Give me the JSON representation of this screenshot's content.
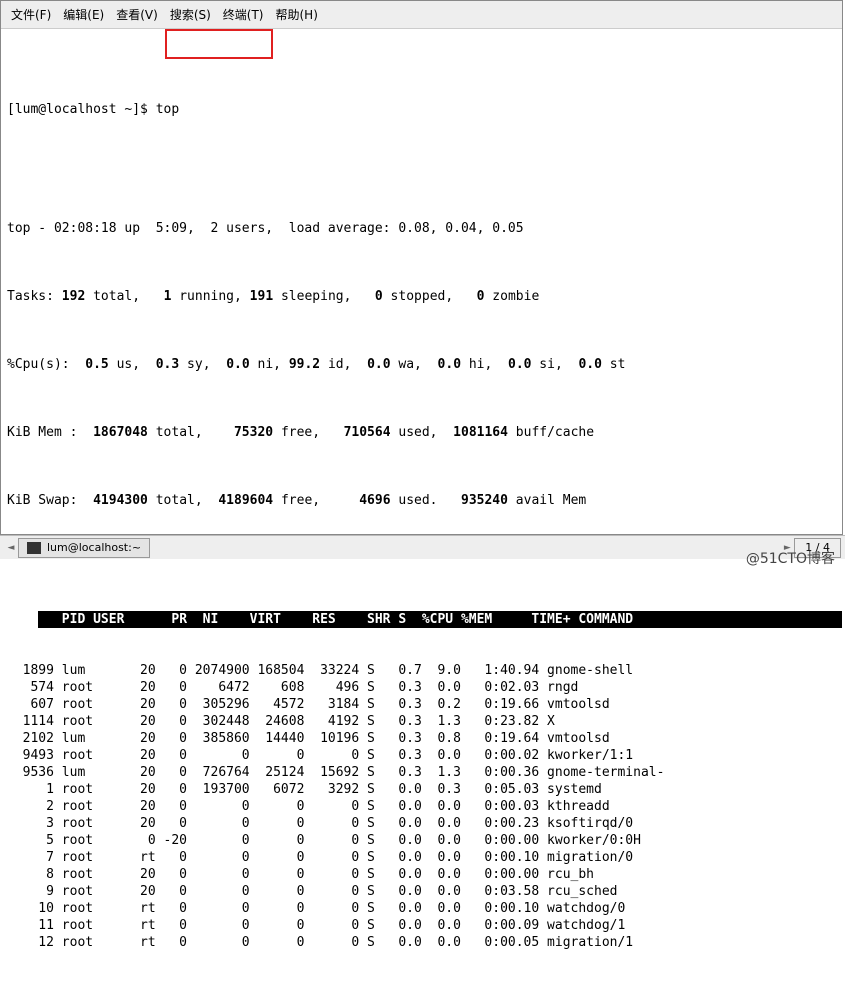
{
  "menu": {
    "file": "文件(F)",
    "edit": "编辑(E)",
    "view": "查看(V)",
    "search": "搜索(S)",
    "terminal": "终端(T)",
    "help": "帮助(H)"
  },
  "prompt": {
    "user_host": "[lum@localhost ~]$ ",
    "command": "top"
  },
  "summary": {
    "line1": "top - 02:08:18 up  5:09,  2 users,  load average: 0.08, 0.04, 0.05",
    "tasks_label": "Tasks: ",
    "tasks_total": "192",
    "tasks_total_text": " total,   ",
    "tasks_running": "1",
    "tasks_running_text": " running, ",
    "tasks_sleeping": "191",
    "tasks_sleeping_text": " sleeping,   ",
    "tasks_stopped": "0",
    "tasks_stopped_text": " stopped,   ",
    "tasks_zombie": "0",
    "tasks_zombie_text": " zombie",
    "cpu_label": "%Cpu(s):  ",
    "cpu_us": "0.5",
    "cpu_us_text": " us,  ",
    "cpu_sy": "0.3",
    "cpu_sy_text": " sy,  ",
    "cpu_ni": "0.0",
    "cpu_ni_text": " ni, ",
    "cpu_id": "99.2",
    "cpu_id_text": " id,  ",
    "cpu_wa": "0.0",
    "cpu_wa_text": " wa,  ",
    "cpu_hi": "0.0",
    "cpu_hi_text": " hi,  ",
    "cpu_si": "0.0",
    "cpu_si_text": " si,  ",
    "cpu_st": "0.0",
    "cpu_st_text": " st",
    "mem_label": "KiB Mem :  ",
    "mem_total": "1867048",
    "mem_total_text": " total,    ",
    "mem_free": "75320",
    "mem_free_text": " free,   ",
    "mem_used": "710564",
    "mem_used_text": " used,  ",
    "mem_buff": "1081164",
    "mem_buff_text": " buff/cache",
    "swap_label": "KiB Swap:  ",
    "swap_total": "4194300",
    "swap_total_text": " total,  ",
    "swap_free": "4189604",
    "swap_free_text": " free,     ",
    "swap_used": "4696",
    "swap_used_text": " used.   ",
    "swap_avail": "935240",
    "swap_avail_text": " avail Mem"
  },
  "header": "   PID USER      PR  NI    VIRT    RES    SHR S  %CPU %MEM     TIME+ COMMAND               ",
  "rows": [
    "  1899 lum       20   0 2074900 168504  33224 S   0.7  9.0   1:40.94 gnome-shell",
    "   574 root      20   0    6472    608    496 S   0.3  0.0   0:02.03 rngd",
    "   607 root      20   0  305296   4572   3184 S   0.3  0.2   0:19.66 vmtoolsd",
    "  1114 root      20   0  302448  24608   4192 S   0.3  1.3   0:23.82 X",
    "  2102 lum       20   0  385860  14440  10196 S   0.3  0.8   0:19.64 vmtoolsd",
    "  9493 root      20   0       0      0      0 S   0.3  0.0   0:00.02 kworker/1:1",
    "  9536 lum       20   0  726764  25124  15692 S   0.3  1.3   0:00.36 gnome-terminal-",
    "     1 root      20   0  193700   6072   3292 S   0.0  0.3   0:05.03 systemd",
    "     2 root      20   0       0      0      0 S   0.0  0.0   0:00.03 kthreadd",
    "     3 root      20   0       0      0      0 S   0.0  0.0   0:00.23 ksoftirqd/0",
    "     5 root       0 -20       0      0      0 S   0.0  0.0   0:00.00 kworker/0:0H",
    "     7 root      rt   0       0      0      0 S   0.0  0.0   0:00.10 migration/0",
    "     8 root      20   0       0      0      0 S   0.0  0.0   0:00.00 rcu_bh",
    "     9 root      20   0       0      0      0 S   0.0  0.0   0:03.58 rcu_sched",
    "    10 root      rt   0       0      0      0 S   0.0  0.0   0:00.10 watchdog/0",
    "    11 root      rt   0       0      0      0 S   0.0  0.0   0:00.09 watchdog/1",
    "    12 root      rt   0       0      0      0 S   0.0  0.0   0:00.05 migration/1"
  ],
  "taskbar": {
    "title": "lum@localhost:~",
    "pager": "1 / 4"
  },
  "watermark": "@51CTO博客"
}
